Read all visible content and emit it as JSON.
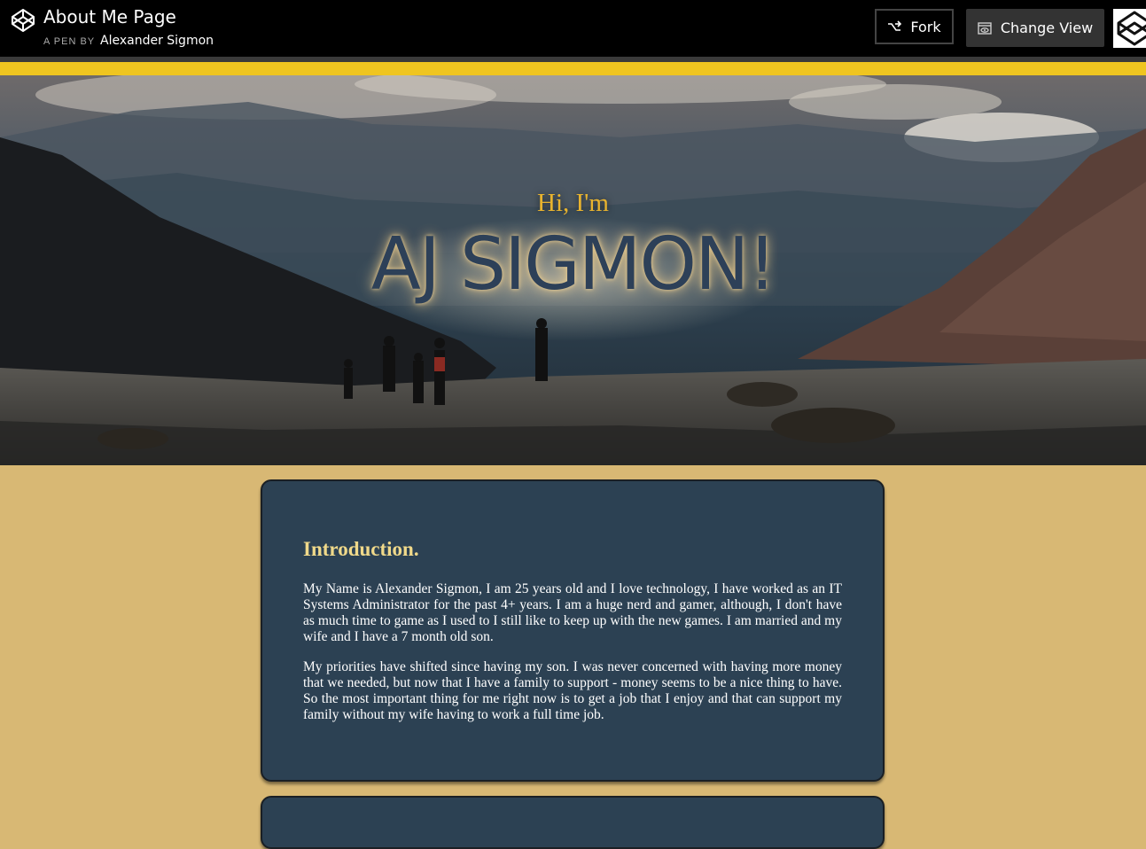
{
  "header": {
    "title": "About Me Page",
    "by_label": "A PEN BY",
    "author": "Alexander Sigmon",
    "fork_label": "Fork",
    "change_view_label": "Change View"
  },
  "hero": {
    "greeting": "Hi, I'm",
    "name": "AJ SIGMON!"
  },
  "intro": {
    "heading": "Introduction.",
    "paragraphs": [
      "My Name is Alexander Sigmon, I am 25 years old and I love technology, I have worked as an IT Systems Administrator for the past 4+ years. I am a huge nerd and gamer, although, I don't have as much time to game as I used to I still like to keep up with the new games. I am married and my wife and I have a 7 month old son.",
      "My priorities have shifted since having my son. I was never concerned with having more money that we needed, but now that I have a family to support - money seems to be a nice thing to have. So the most important thing for me right now is to get a job that I enjoy and that can support my family without my wife having to work a full time job."
    ]
  },
  "colors": {
    "page_background": "#d8b874",
    "card_background": "#2c4153",
    "accent_yellow": "#efc520",
    "greeting_color": "#e8b32e",
    "name_color": "#2d4058",
    "heading_color": "#f0d98a"
  },
  "icons": {
    "brand": "codepen-logo-icon",
    "fork": "fork-icon",
    "change_view": "eye-window-icon",
    "corner": "codepen-logo-icon"
  }
}
